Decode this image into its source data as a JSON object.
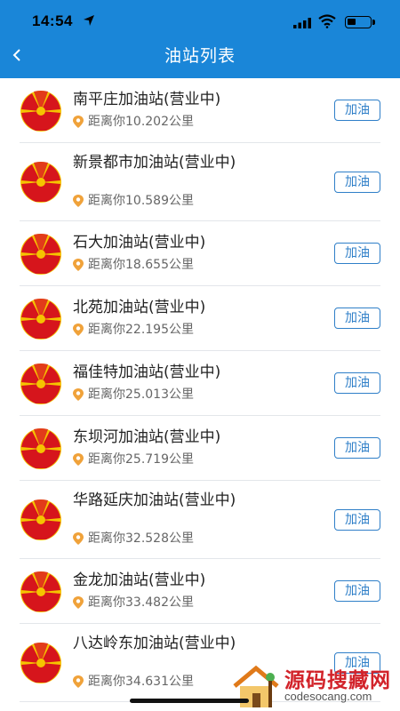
{
  "status_bar": {
    "time": "14:54"
  },
  "header": {
    "title": "油站列表"
  },
  "colors": {
    "header_bg": "#1a86d8",
    "button_accent": "#2f7fc8",
    "pin_orange": "#f0a23a",
    "logo_red": "#d6151c",
    "logo_yellow": "#f5c400"
  },
  "stations": [
    {
      "name": "南平庄加油站(营业中)",
      "distance": "距离你10.202公里",
      "button": "加油"
    },
    {
      "name": "新景都市加油站(营业中)",
      "distance": "距离你10.589公里",
      "button": "加油"
    },
    {
      "name": "石大加油站(营业中)",
      "distance": "距离你18.655公里",
      "button": "加油"
    },
    {
      "name": "北苑加油站(营业中)",
      "distance": "距离你22.195公里",
      "button": "加油"
    },
    {
      "name": "福佳特加油站(营业中)",
      "distance": "距离你25.013公里",
      "button": "加油"
    },
    {
      "name": "东坝河加油站(营业中)",
      "distance": "距离你25.719公里",
      "button": "加油"
    },
    {
      "name": "华路延庆加油站(营业中)",
      "distance": "距离你32.528公里",
      "button": "加油"
    },
    {
      "name": "金龙加油站(营业中)",
      "distance": "距离你33.482公里",
      "button": "加油"
    },
    {
      "name": "八达岭东加油站(营业中)",
      "distance": "距离你34.631公里",
      "button": "加油"
    }
  ],
  "watermark": {
    "text": "源码搜藏网",
    "url": "codesocang.com"
  }
}
